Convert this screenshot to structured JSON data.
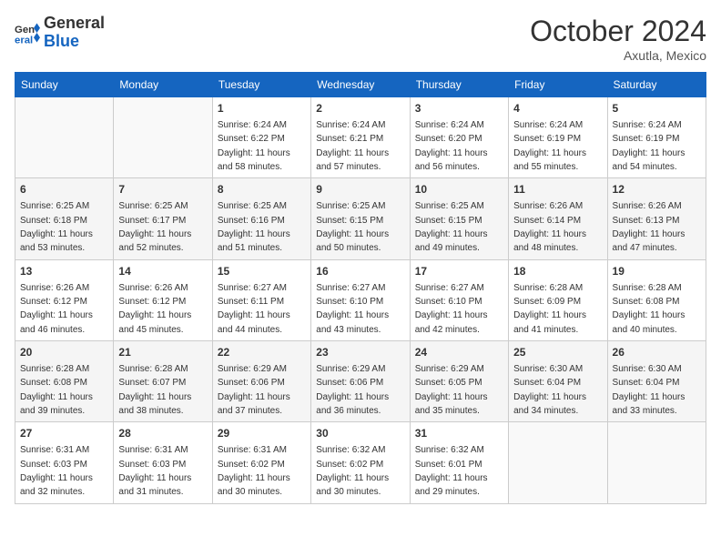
{
  "logo": {
    "line1": "General",
    "line2": "Blue"
  },
  "title": "October 2024",
  "subtitle": "Axutla, Mexico",
  "days_of_week": [
    "Sunday",
    "Monday",
    "Tuesday",
    "Wednesday",
    "Thursday",
    "Friday",
    "Saturday"
  ],
  "weeks": [
    [
      {
        "day": "",
        "sunrise": "",
        "sunset": "",
        "daylight": ""
      },
      {
        "day": "",
        "sunrise": "",
        "sunset": "",
        "daylight": ""
      },
      {
        "day": "1",
        "sunrise": "Sunrise: 6:24 AM",
        "sunset": "Sunset: 6:22 PM",
        "daylight": "Daylight: 11 hours and 58 minutes."
      },
      {
        "day": "2",
        "sunrise": "Sunrise: 6:24 AM",
        "sunset": "Sunset: 6:21 PM",
        "daylight": "Daylight: 11 hours and 57 minutes."
      },
      {
        "day": "3",
        "sunrise": "Sunrise: 6:24 AM",
        "sunset": "Sunset: 6:20 PM",
        "daylight": "Daylight: 11 hours and 56 minutes."
      },
      {
        "day": "4",
        "sunrise": "Sunrise: 6:24 AM",
        "sunset": "Sunset: 6:19 PM",
        "daylight": "Daylight: 11 hours and 55 minutes."
      },
      {
        "day": "5",
        "sunrise": "Sunrise: 6:24 AM",
        "sunset": "Sunset: 6:19 PM",
        "daylight": "Daylight: 11 hours and 54 minutes."
      }
    ],
    [
      {
        "day": "6",
        "sunrise": "Sunrise: 6:25 AM",
        "sunset": "Sunset: 6:18 PM",
        "daylight": "Daylight: 11 hours and 53 minutes."
      },
      {
        "day": "7",
        "sunrise": "Sunrise: 6:25 AM",
        "sunset": "Sunset: 6:17 PM",
        "daylight": "Daylight: 11 hours and 52 minutes."
      },
      {
        "day": "8",
        "sunrise": "Sunrise: 6:25 AM",
        "sunset": "Sunset: 6:16 PM",
        "daylight": "Daylight: 11 hours and 51 minutes."
      },
      {
        "day": "9",
        "sunrise": "Sunrise: 6:25 AM",
        "sunset": "Sunset: 6:15 PM",
        "daylight": "Daylight: 11 hours and 50 minutes."
      },
      {
        "day": "10",
        "sunrise": "Sunrise: 6:25 AM",
        "sunset": "Sunset: 6:15 PM",
        "daylight": "Daylight: 11 hours and 49 minutes."
      },
      {
        "day": "11",
        "sunrise": "Sunrise: 6:26 AM",
        "sunset": "Sunset: 6:14 PM",
        "daylight": "Daylight: 11 hours and 48 minutes."
      },
      {
        "day": "12",
        "sunrise": "Sunrise: 6:26 AM",
        "sunset": "Sunset: 6:13 PM",
        "daylight": "Daylight: 11 hours and 47 minutes."
      }
    ],
    [
      {
        "day": "13",
        "sunrise": "Sunrise: 6:26 AM",
        "sunset": "Sunset: 6:12 PM",
        "daylight": "Daylight: 11 hours and 46 minutes."
      },
      {
        "day": "14",
        "sunrise": "Sunrise: 6:26 AM",
        "sunset": "Sunset: 6:12 PM",
        "daylight": "Daylight: 11 hours and 45 minutes."
      },
      {
        "day": "15",
        "sunrise": "Sunrise: 6:27 AM",
        "sunset": "Sunset: 6:11 PM",
        "daylight": "Daylight: 11 hours and 44 minutes."
      },
      {
        "day": "16",
        "sunrise": "Sunrise: 6:27 AM",
        "sunset": "Sunset: 6:10 PM",
        "daylight": "Daylight: 11 hours and 43 minutes."
      },
      {
        "day": "17",
        "sunrise": "Sunrise: 6:27 AM",
        "sunset": "Sunset: 6:10 PM",
        "daylight": "Daylight: 11 hours and 42 minutes."
      },
      {
        "day": "18",
        "sunrise": "Sunrise: 6:28 AM",
        "sunset": "Sunset: 6:09 PM",
        "daylight": "Daylight: 11 hours and 41 minutes."
      },
      {
        "day": "19",
        "sunrise": "Sunrise: 6:28 AM",
        "sunset": "Sunset: 6:08 PM",
        "daylight": "Daylight: 11 hours and 40 minutes."
      }
    ],
    [
      {
        "day": "20",
        "sunrise": "Sunrise: 6:28 AM",
        "sunset": "Sunset: 6:08 PM",
        "daylight": "Daylight: 11 hours and 39 minutes."
      },
      {
        "day": "21",
        "sunrise": "Sunrise: 6:28 AM",
        "sunset": "Sunset: 6:07 PM",
        "daylight": "Daylight: 11 hours and 38 minutes."
      },
      {
        "day": "22",
        "sunrise": "Sunrise: 6:29 AM",
        "sunset": "Sunset: 6:06 PM",
        "daylight": "Daylight: 11 hours and 37 minutes."
      },
      {
        "day": "23",
        "sunrise": "Sunrise: 6:29 AM",
        "sunset": "Sunset: 6:06 PM",
        "daylight": "Daylight: 11 hours and 36 minutes."
      },
      {
        "day": "24",
        "sunrise": "Sunrise: 6:29 AM",
        "sunset": "Sunset: 6:05 PM",
        "daylight": "Daylight: 11 hours and 35 minutes."
      },
      {
        "day": "25",
        "sunrise": "Sunrise: 6:30 AM",
        "sunset": "Sunset: 6:04 PM",
        "daylight": "Daylight: 11 hours and 34 minutes."
      },
      {
        "day": "26",
        "sunrise": "Sunrise: 6:30 AM",
        "sunset": "Sunset: 6:04 PM",
        "daylight": "Daylight: 11 hours and 33 minutes."
      }
    ],
    [
      {
        "day": "27",
        "sunrise": "Sunrise: 6:31 AM",
        "sunset": "Sunset: 6:03 PM",
        "daylight": "Daylight: 11 hours and 32 minutes."
      },
      {
        "day": "28",
        "sunrise": "Sunrise: 6:31 AM",
        "sunset": "Sunset: 6:03 PM",
        "daylight": "Daylight: 11 hours and 31 minutes."
      },
      {
        "day": "29",
        "sunrise": "Sunrise: 6:31 AM",
        "sunset": "Sunset: 6:02 PM",
        "daylight": "Daylight: 11 hours and 30 minutes."
      },
      {
        "day": "30",
        "sunrise": "Sunrise: 6:32 AM",
        "sunset": "Sunset: 6:02 PM",
        "daylight": "Daylight: 11 hours and 30 minutes."
      },
      {
        "day": "31",
        "sunrise": "Sunrise: 6:32 AM",
        "sunset": "Sunset: 6:01 PM",
        "daylight": "Daylight: 11 hours and 29 minutes."
      },
      {
        "day": "",
        "sunrise": "",
        "sunset": "",
        "daylight": ""
      },
      {
        "day": "",
        "sunrise": "",
        "sunset": "",
        "daylight": ""
      }
    ]
  ]
}
